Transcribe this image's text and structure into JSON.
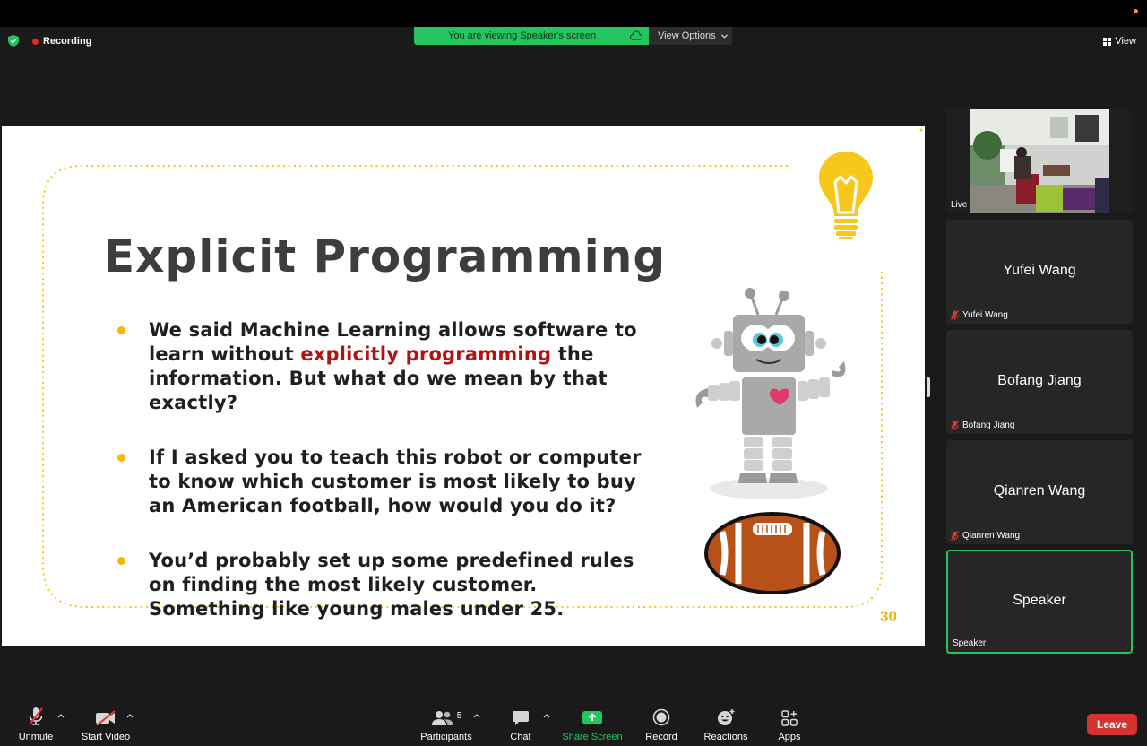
{
  "topbar": {
    "recording_label": "Recording",
    "viewing_label": "You are viewing Speaker's screen",
    "view_options_label": "View Options",
    "view_label": "View"
  },
  "slide": {
    "title": "Explicit Programming",
    "bullets": [
      {
        "pre": "We said Machine Learning allows software to learn without ",
        "em": "explicitly programming",
        "post": " the information. But what do we mean by that exactly?"
      },
      {
        "pre": "If I asked you to teach this robot or computer to know which customer is most likely to buy an American football, how would you do it?",
        "em": "",
        "post": ""
      },
      {
        "pre": "You’d probably set up some predefined rules on finding the most likely customer. Something like young males under 25.",
        "em": "",
        "post": ""
      }
    ],
    "page_number": "30"
  },
  "gallery": {
    "live": {
      "label": "Live"
    },
    "participants": [
      {
        "name": "Yufei Wang",
        "label": "Yufei Wang",
        "muted": true
      },
      {
        "name": "Bofang Jiang",
        "label": "Bofang Jiang",
        "muted": true
      },
      {
        "name": "Qianren Wang",
        "label": "Qianren Wang",
        "muted": true
      },
      {
        "name": "Speaker",
        "label": "Speaker",
        "muted": false,
        "active": true
      }
    ]
  },
  "toolbar": {
    "unmute_label": "Unmute",
    "start_video_label": "Start Video",
    "participants_label": "Participants",
    "participants_count": "5",
    "chat_label": "Chat",
    "share_screen_label": "Share Screen",
    "record_label": "Record",
    "reactions_label": "Reactions",
    "apps_label": "Apps",
    "leave_label": "Leave"
  },
  "colors": {
    "accent_green": "#22c55e",
    "leave_red": "#d63232",
    "slide_highlight": "#b31212",
    "bullet_yellow": "#f5b70a"
  }
}
